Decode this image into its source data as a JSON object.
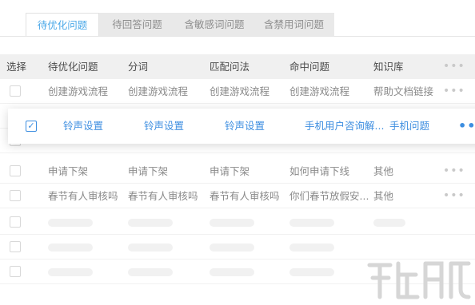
{
  "tabs": [
    {
      "label": "待优化问题"
    },
    {
      "label": "待回答问题"
    },
    {
      "label": "含敏感词问题"
    },
    {
      "label": "含禁用词问题"
    }
  ],
  "table": {
    "headers": [
      "选择",
      "待优化问题",
      "分词",
      "匹配问法",
      "命中问题",
      "知识库"
    ],
    "more_label": "•••",
    "rows": [
      [
        "创建游戏流程",
        "创建游戏流程",
        "创建游戏流程",
        "创建游戏流程",
        "帮助文档链接"
      ],
      [
        "",
        "",
        "",
        "",
        ""
      ],
      [
        "",
        "",
        "",
        "",
        ""
      ],
      [
        "申请下架",
        "申请下架",
        "申请下架",
        "如何申请下线",
        "其他"
      ],
      [
        "春节有人审核吗",
        "春节有人审核吗",
        "春节有人审核吗",
        "你们春节放假安...",
        "其他"
      ]
    ]
  },
  "selected_row": {
    "checkbox": "✓",
    "cells": [
      "铃声设置",
      "铃声设置",
      "铃声设置",
      "手机用户咨询解...",
      "手机问题"
    ],
    "more_label": "•••"
  },
  "colors": {
    "accent": "#3d8ee0",
    "active_tab_text": "#4aa8e8",
    "header_bg": "#f0f0f0",
    "tab_bar_bg": "#e9e9e9"
  }
}
